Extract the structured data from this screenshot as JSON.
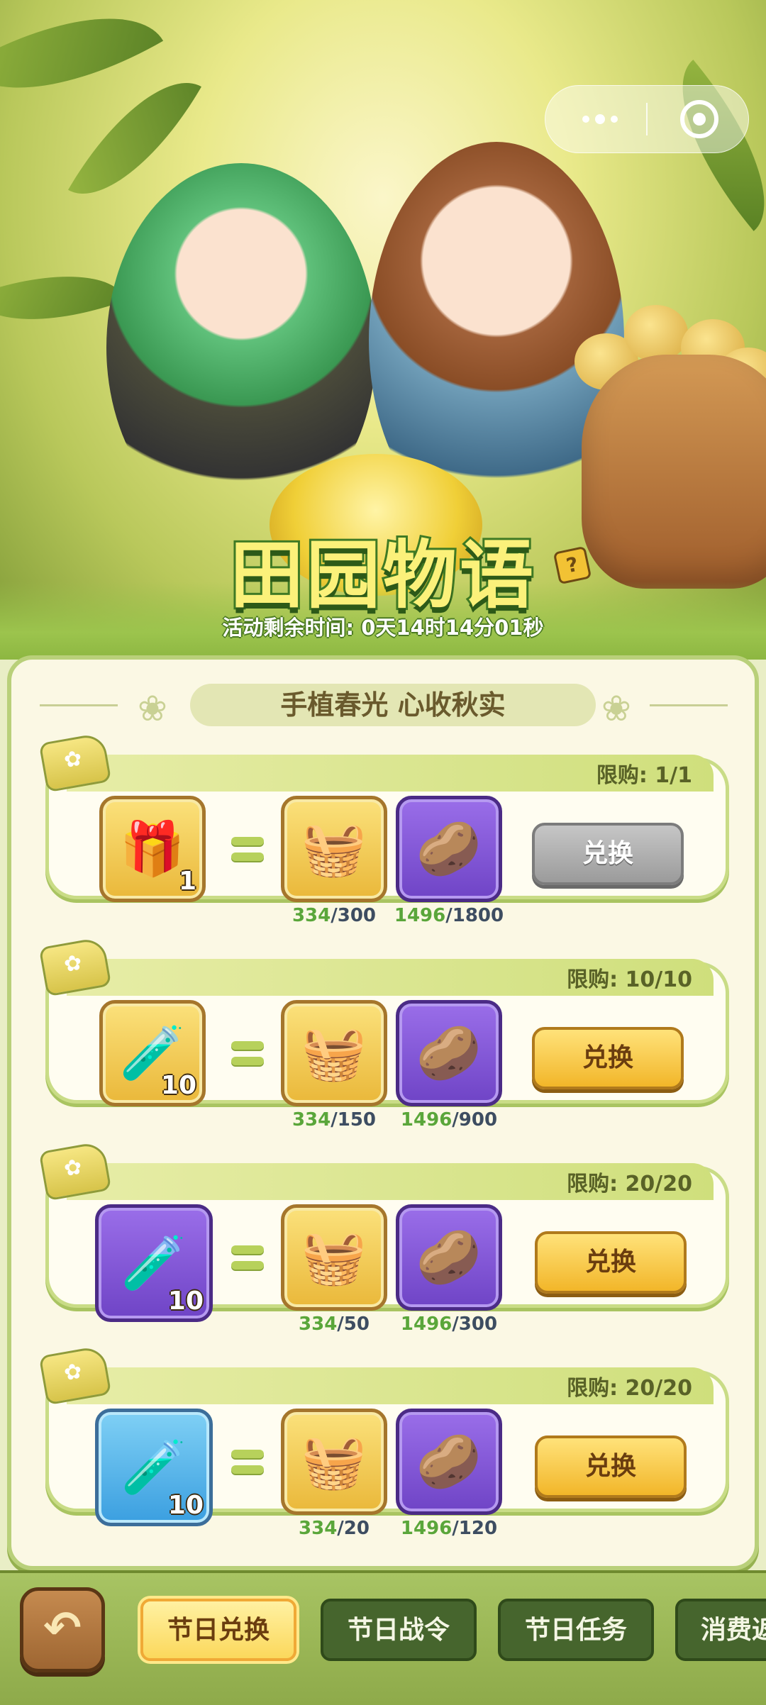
{
  "header": {
    "title": "田园物语",
    "countdown_label": "活动剩余时间: 0天14时14分01秒",
    "help_icon": "?"
  },
  "panel": {
    "subtitle": "手植春光 心收秋实"
  },
  "exchange_items": [
    {
      "limit": "限购: 1/1",
      "reward_icon": "mystery-chest-icon",
      "reward_qty": "1",
      "cost1_icon": "vegetable-basket-icon",
      "cost1_have": "334",
      "cost1_need": "/300",
      "cost2_icon": "seeds-icon",
      "cost2_have": "1496",
      "cost2_need": "/1800",
      "button": "兑换",
      "enabled": false
    },
    {
      "limit": "限购: 10/10",
      "reward_icon": "orange-potion-icon",
      "reward_qty": "10",
      "cost1_icon": "vegetable-basket-icon",
      "cost1_have": "334",
      "cost1_need": "/150",
      "cost2_icon": "seeds-icon",
      "cost2_have": "1496",
      "cost2_need": "/900",
      "button": "兑换",
      "enabled": true
    },
    {
      "limit": "限购: 20/20",
      "reward_icon": "purple-potion-icon",
      "reward_qty": "10",
      "cost1_icon": "vegetable-basket-icon",
      "cost1_have": "334",
      "cost1_need": "/50",
      "cost2_icon": "seeds-icon",
      "cost2_have": "1496",
      "cost2_need": "/300",
      "button": "兑换",
      "enabled": true
    },
    {
      "limit": "限购: 20/20",
      "reward_icon": "blue-potion-icon",
      "reward_qty": "10",
      "cost1_icon": "vegetable-basket-icon",
      "cost1_have": "334",
      "cost1_need": "/20",
      "cost2_icon": "seeds-icon",
      "cost2_have": "1496",
      "cost2_need": "/120",
      "button": "兑换",
      "enabled": true
    }
  ],
  "bottom_nav": {
    "back_icon": "back-arrow-icon",
    "tabs": [
      {
        "label": "节日兑换",
        "active": true
      },
      {
        "label": "节日战令",
        "active": false
      },
      {
        "label": "节日任务",
        "active": false
      },
      {
        "label": "消费返",
        "active": false
      }
    ]
  },
  "colors": {
    "accent_green": "#b9d07a",
    "button_gold": "#f2b629",
    "button_disabled": "#9b9b9b",
    "have_value": "#5aa63a"
  }
}
